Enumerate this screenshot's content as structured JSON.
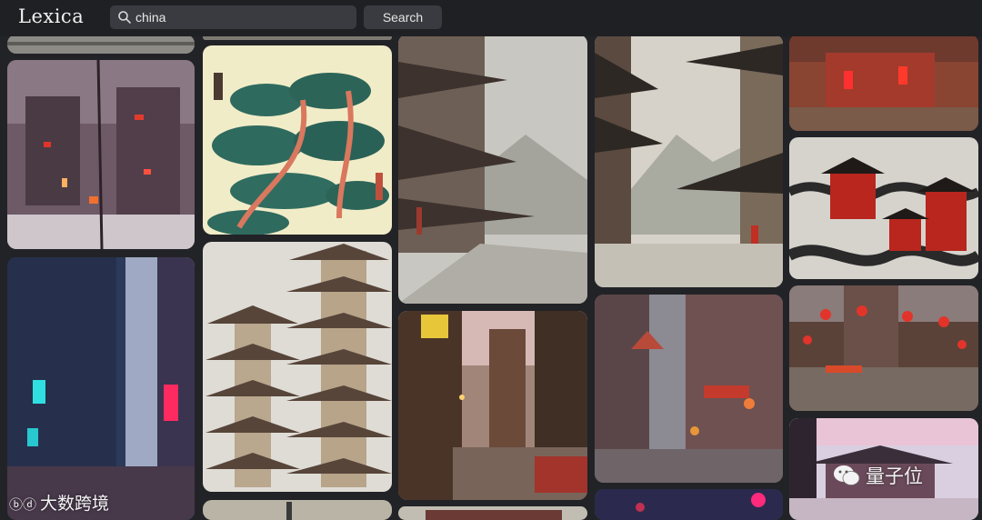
{
  "app": {
    "logo": "Lexica"
  },
  "search": {
    "value": "china",
    "button_label": "Search"
  },
  "watermarks": {
    "left": "大数跨境",
    "right": "量子位"
  },
  "theme": {
    "background": "#222327",
    "topbar": "#1f2024",
    "input_bg": "#3a3b40",
    "text": "#f2f2f2"
  },
  "gallery": {
    "icon": "image-tile",
    "images": [
      "snowy-city-night",
      "green-pine-scroll",
      "ink-street-fog",
      "ink-mountain-street",
      "red-lantern-street",
      "ink-pagodas-clouds",
      "neon-alley",
      "twin-pagoda-towers",
      "bazaar-night",
      "foggy-pagoda-city",
      "lantern-market",
      "palace-pink-sky"
    ]
  }
}
